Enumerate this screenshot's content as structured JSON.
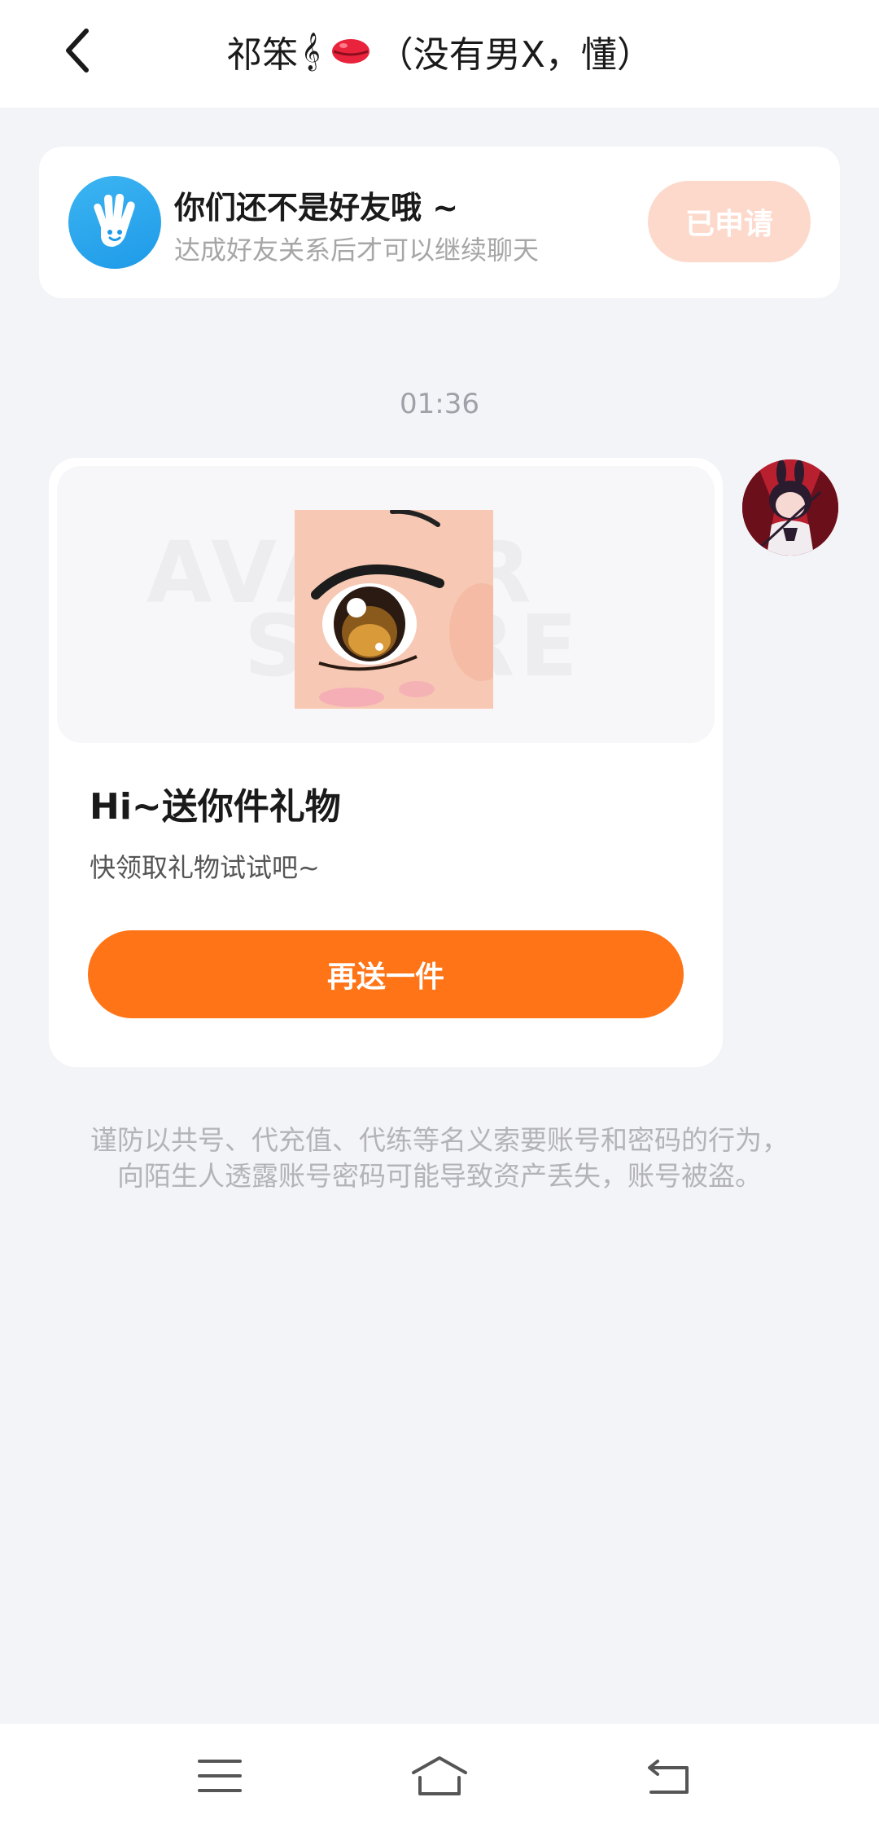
{
  "header": {
    "title_prefix": "祁笨",
    "title_deco": "𝄞",
    "title_suffix": "（没有男X，懂）"
  },
  "notice": {
    "title": "你们还不是好友哦 ~",
    "subtitle": "达成好友关系后才可以继续聊天",
    "button_label": "已申请"
  },
  "chat": {
    "time": "01:36"
  },
  "gift_card": {
    "watermark_line1": "AVATAR",
    "watermark_line2": "STORE",
    "title": "Hi~送你件礼物",
    "subtitle": "快领取礼物试试吧~",
    "button_label": "再送一件"
  },
  "warning_text": "谨防以共号、代充值、代练等名义索要账号和密码的行为，向陌生人透露账号密码可能导致资产丢失，账号被盗。",
  "colors": {
    "accent": "#ff7417",
    "applied_bg": "#fdd9cc",
    "page_bg": "#f3f4f8",
    "notice_icon": "#1e9ae8"
  },
  "icons": {
    "back": "chevron-left-icon",
    "notice": "hand-wave-icon",
    "nav_menu": "menu-icon",
    "nav_home": "home-icon",
    "nav_back": "return-icon"
  }
}
